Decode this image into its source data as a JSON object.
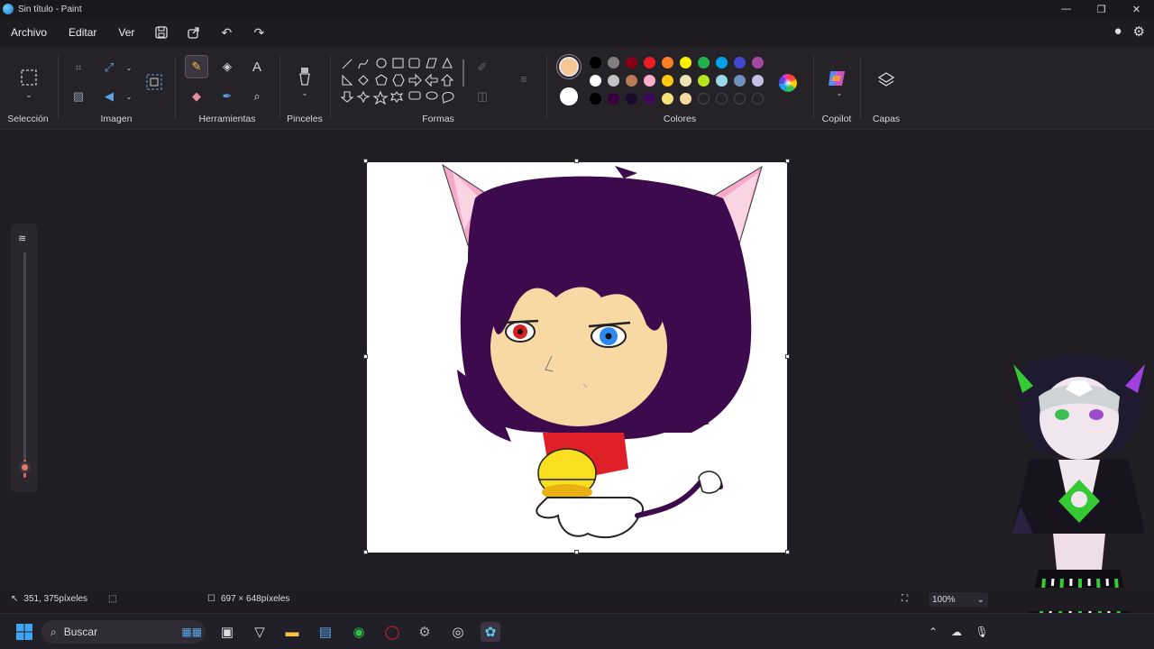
{
  "window": {
    "title": "Sin título - Paint",
    "controls": [
      "minimize-icon",
      "restore-icon",
      "close-icon"
    ]
  },
  "menu": {
    "items": [
      "Archivo",
      "Editar",
      "Ver"
    ],
    "quick_actions": [
      "save-icon",
      "share-icon",
      "undo-icon",
      "redo-icon"
    ],
    "right_icons": [
      "account-icon",
      "settings-icon"
    ]
  },
  "ribbon": {
    "groups": {
      "selection": "Selección",
      "image": "Imagen",
      "tools": "Herramientas",
      "brushes": "Pinceles",
      "shapes": "Formas",
      "colors": "Colores",
      "copilot": "Copilot",
      "layers": "Capas"
    },
    "colors": {
      "primary": "#f7c793",
      "secondary": "#ffffff",
      "palette_row1": [
        "#000000",
        "#7f7f7f",
        "#880015",
        "#ed1c24",
        "#ff7f27",
        "#fff200",
        "#22b14c",
        "#00a2e8",
        "#3f48cc",
        "#a349a4"
      ],
      "palette_row2": [
        "#ffffff",
        "#c3c3c3",
        "#b97a57",
        "#ffaec9",
        "#ffc90e",
        "#efe4b0",
        "#b5e61d",
        "#99d9ea",
        "#7092be",
        "#c8bfe7"
      ],
      "palette_row3": [
        "#000000",
        "#3a003f",
        "#1c0a2c",
        "#3c0a55",
        "#f7e27a",
        "#f7d9a0",
        "",
        "",
        "",
        ""
      ]
    }
  },
  "status": {
    "cursor_position": "351, 375píxeles",
    "canvas_size": "697 × 648píxeles",
    "zoom": "100%"
  },
  "taskbar": {
    "search_placeholder": "Buscar",
    "apps": [
      "windows-start-icon",
      "search-icon",
      "task-view-icon",
      "vivaldi-icon",
      "file-explorer-icon",
      "store-icon",
      "whatsapp-icon",
      "opera-icon",
      "settings-app-icon",
      "steam-icon",
      "paint-app-icon"
    ]
  }
}
